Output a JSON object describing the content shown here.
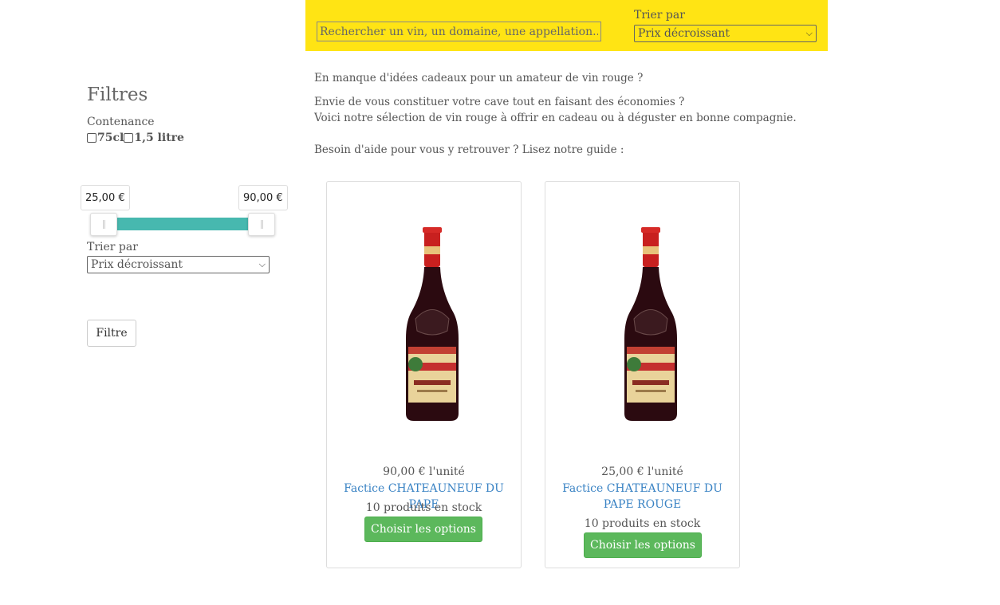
{
  "search": {
    "placeholder": "Rechercher un vin, un domaine, une appellation..."
  },
  "top_sort": {
    "label": "Trier par",
    "selected": "Prix décroissant"
  },
  "filters": {
    "title": "Filtres",
    "contenance_label": "Contenance",
    "options": [
      "75cl",
      "1,5 litre"
    ],
    "price_min": "25,00 €",
    "price_max": "90,00 €",
    "range_fill_fraction": 1.0,
    "sort_label": "Trier par",
    "sort_selected": "Prix décroissant",
    "filter_button": "Filtre",
    "slider_color": "#47b8af"
  },
  "intro": {
    "line1": "En manque d'idées cadeaux pour un amateur de vin rouge ?",
    "line2": "Envie de vous constituer votre cave tout en faisant des économies ?",
    "line3": "Voici notre sélection de vin rouge à offrir en cadeau ou à déguster en bonne compagnie.",
    "line4": "Besoin d'aide pour vous y retrouver ? Lisez notre guide :"
  },
  "products": [
    {
      "price": "90,00 € l'unité",
      "title": "Factice CHATEAUNEUF DU PAPE",
      "stock": "10 produits en stock",
      "button": "Choisir les options"
    },
    {
      "price": "25,00 € l'unité",
      "title": "Factice CHATEAUNEUF DU PAPE ROUGE",
      "stock": "10 produits en stock",
      "button": "Choisir les options"
    }
  ],
  "colors": {
    "topbar": "#ffe414",
    "button_green": "#5cb85c",
    "link_blue": "#3a83c4"
  }
}
